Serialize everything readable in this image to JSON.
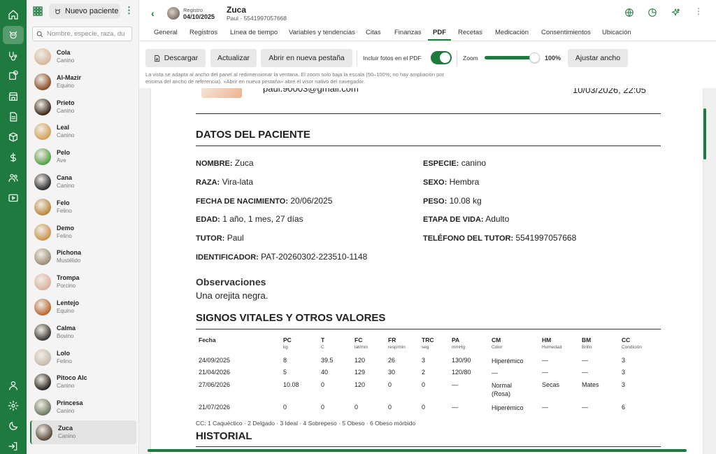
{
  "header": {
    "registro_label": "Registro",
    "registro_date": "04/10/2025",
    "patient_name": "Zuca",
    "patient_sub": "Paul · 5541997057668"
  },
  "sidebar": {
    "new_patient": "Nuevo paciente",
    "search_placeholder": "Nombre, especie, raza, du",
    "patients": [
      {
        "name": "Cola",
        "species": "Canino",
        "color": "#d8b79c"
      },
      {
        "name": "Al-Mazir",
        "species": "Equino",
        "color": "#8a4f2a"
      },
      {
        "name": "Prieto",
        "species": "Canino",
        "color": "#3d2a1e"
      },
      {
        "name": "Leal",
        "species": "Canino",
        "color": "#d2a25c"
      },
      {
        "name": "Pelo",
        "species": "Ave",
        "color": "#5aa04a"
      },
      {
        "name": "Cana",
        "species": "Canino",
        "color": "#2f2f2f"
      },
      {
        "name": "Felo",
        "species": "Felino",
        "color": "#b8893f"
      },
      {
        "name": "Demo",
        "species": "Felino",
        "color": "#c99552"
      },
      {
        "name": "Pichona",
        "species": "Mustélido",
        "color": "#9a8f78"
      },
      {
        "name": "Trompa",
        "species": "Porcino",
        "color": "#d9b3a0"
      },
      {
        "name": "Lentejo",
        "species": "Equino",
        "color": "#b86a34"
      },
      {
        "name": "Calma",
        "species": "Bovino",
        "color": "#3f3a36"
      },
      {
        "name": "Lolo",
        "species": "Felino",
        "color": "#c7bbb0"
      },
      {
        "name": "Pitoco Alc",
        "species": "Canino",
        "color": "#2c2521"
      },
      {
        "name": "Princesa",
        "species": "Canino",
        "color": "#6f7a63"
      },
      {
        "name": "Zuca",
        "species": "Canino",
        "color": "#5a4a3e"
      }
    ]
  },
  "tabs": [
    "General",
    "Registros",
    "Línea de tiempo",
    "Variables y tendencias",
    "Citas",
    "Finanzas",
    "PDF",
    "Recetas",
    "Medicación",
    "Consentimientos",
    "Ubicación"
  ],
  "toolbar": {
    "download": "Descargar",
    "update": "Actualizar",
    "open_new_tab": "Abrir en nueva pestaña",
    "include_photos": "Incluir fotos en el PDF",
    "include_photos_on": true,
    "zoom_label": "Zoom",
    "zoom_value": "100%",
    "zoom_fraction": 1.0,
    "fit_width": "Ajustar ancho",
    "note": "La vista se adapta al ancho del panel al redimensionar la ventana. El zoom solo baja la escala (50–100%; no hay ampliación por encima del ancho de referencia). «Abrir en nueva pestaña» abre el visor nativo del navegador."
  },
  "pdf": {
    "email_partial": "paul.90003@gmail.com",
    "datetime_partial": "10/03/2026, 22:05",
    "section_patient": "DATOS DEL PACIENTE",
    "fields_left": [
      {
        "label": "NOMBRE:",
        "value": "Zuca"
      },
      {
        "label": "RAZA:",
        "value": "Vira-lata"
      },
      {
        "label": "FECHA DE NACIMIENTO:",
        "value": "20/06/2025"
      },
      {
        "label": "EDAD:",
        "value": "1 año, 1 mes, 27 días"
      },
      {
        "label": "TUTOR:",
        "value": "Paul"
      },
      {
        "label": "IDENTIFICADOR:",
        "value": "PAT-20260302-223510-1148"
      }
    ],
    "fields_right": [
      {
        "label": "ESPECIE:",
        "value": "canino"
      },
      {
        "label": "SEXO:",
        "value": "Hembra"
      },
      {
        "label": "PESO:",
        "value": "10.08 kg"
      },
      {
        "label": "ETAPA DE VIDA:",
        "value": "Adulto"
      },
      {
        "label": "TELÉFONO DEL TUTOR:",
        "value": "5541997057668"
      }
    ],
    "obs_title": "Observaciones",
    "obs_text": "Una orejita negra.",
    "section_vitals": "SIGNOS VITALES Y OTROS VALORES",
    "vitals_headers": [
      {
        "h": "Fecha",
        "s": ""
      },
      {
        "h": "PC",
        "s": "kg"
      },
      {
        "h": "T",
        "s": "C"
      },
      {
        "h": "FC",
        "s": "lat/min"
      },
      {
        "h": "FR",
        "s": "resp/min"
      },
      {
        "h": "TRC",
        "s": "seg"
      },
      {
        "h": "PA",
        "s": "mmHg"
      },
      {
        "h": "CM",
        "s": "Color"
      },
      {
        "h": "HM",
        "s": "Humedad"
      },
      {
        "h": "BM",
        "s": "Brillo"
      },
      {
        "h": "CC",
        "s": "Condición"
      }
    ],
    "vitals_rows": [
      [
        "24/09/2025",
        "8",
        "39.5",
        "120",
        "26",
        "3",
        "130/90",
        "Hiperémico",
        "—",
        "—",
        "3"
      ],
      [
        "21/04/2026",
        "5",
        "40",
        "129",
        "30",
        "2",
        "120/80",
        "—",
        "—",
        "—",
        "3"
      ],
      [
        "27/06/2026",
        "10.08",
        "0",
        "120",
        "0",
        "0",
        "—",
        "Normal (Rosa)",
        "Secas",
        "Mates",
        "3"
      ],
      [
        "21/07/2026",
        "0",
        "0",
        "0",
        "0",
        "0",
        "—",
        "Hiperémico",
        "—",
        "—",
        "6"
      ]
    ],
    "cc_legend": "CC: 1 Caquéctico · 2 Delgado · 3 Ideal · 4 Sobrepeso · 5 Obeso · 6 Obeso mórbido",
    "section_history": "HISTORIAL"
  }
}
